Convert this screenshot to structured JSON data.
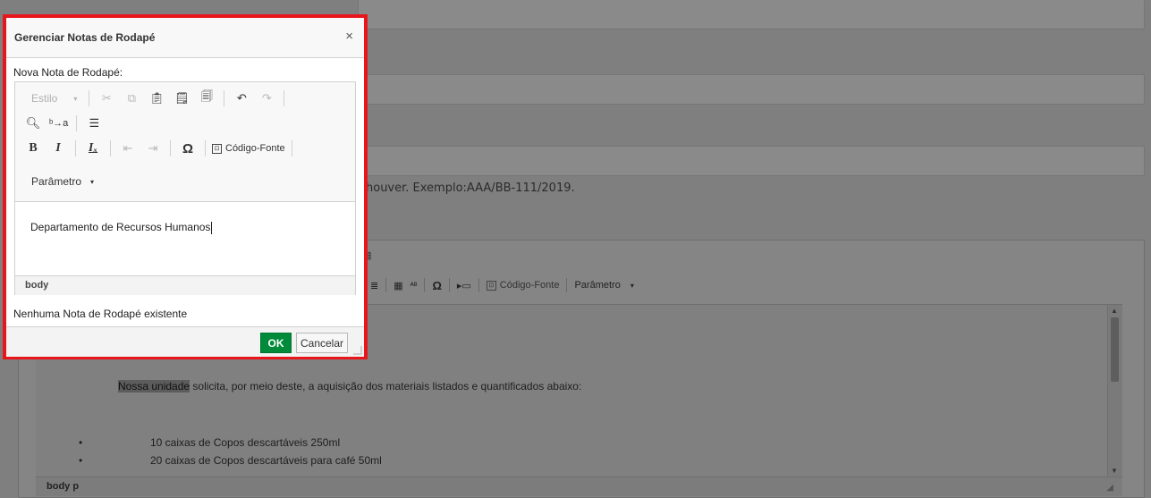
{
  "background": {
    "hint_text": "houver. Exemplo:AAA/BB-111/2019.",
    "toolbar": {
      "source_label": "Código-Fonte",
      "param_label": "Parâmetro"
    },
    "content": {
      "highlight": "Nossa unidade",
      "paragraph_rest": " solicita, por meio deste, a aquisição dos materiais listados e quantificados abaixo:",
      "items": [
        "10 caixas de Copos descartáveis 250ml",
        "20 caixas de Copos descartáveis para café 50ml"
      ]
    },
    "status_path": "body  p"
  },
  "dialog": {
    "title": "Gerenciar Notas de Rodapé",
    "close_glyph": "×",
    "new_note_label": "Nova Nota de Rodapé:",
    "editor": {
      "style_combo": "Estilo",
      "source_label": "Código-Fonte",
      "param_label": "Parâmetro",
      "content_text": "Departamento de Recursos Humanos",
      "status_path": "body"
    },
    "empty_message": "Nenhuma Nota de Rodapé existente",
    "ok_label": "OK",
    "cancel_label": "Cancelar"
  },
  "colors": {
    "highlight_border": "#e8151b",
    "ok_button": "#008a3a",
    "overlay": "#7f7f7f"
  }
}
